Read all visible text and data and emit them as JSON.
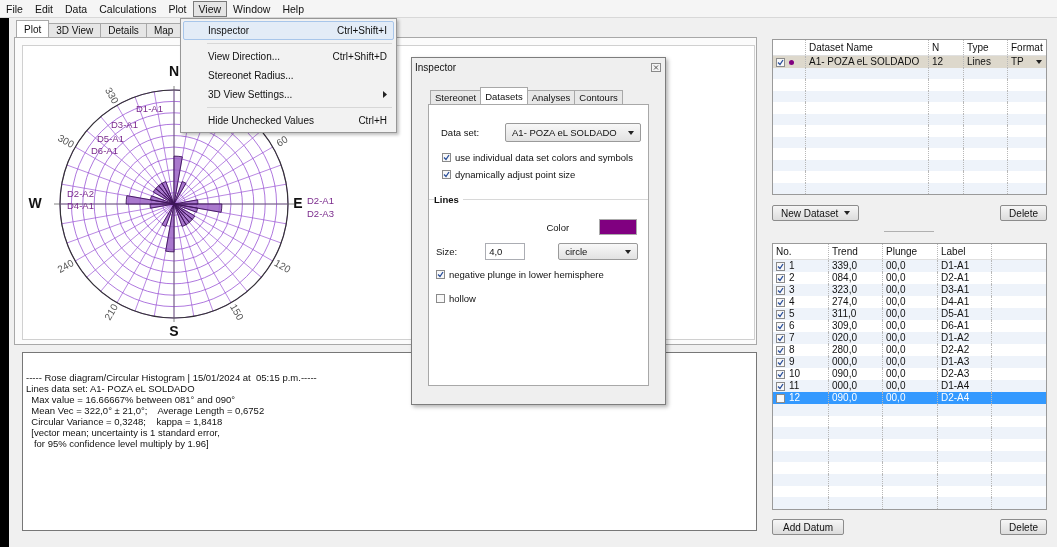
{
  "menu_bar": [
    {
      "label": "File",
      "selected": false
    },
    {
      "label": "Edit",
      "selected": false
    },
    {
      "label": "Data",
      "selected": false
    },
    {
      "label": "Calculations",
      "selected": false
    },
    {
      "label": "Plot",
      "selected": false
    },
    {
      "label": "View",
      "selected": true
    },
    {
      "label": "Window",
      "selected": false
    },
    {
      "label": "Help",
      "selected": false
    }
  ],
  "view_menu": [
    {
      "kind": "item",
      "label": "Inspector",
      "shortcut": "Ctrl+Shift+I",
      "selected": true,
      "submenu": false
    },
    {
      "kind": "separator"
    },
    {
      "kind": "item",
      "label": "View Direction...",
      "shortcut": "Ctrl+Shift+D",
      "selected": false,
      "submenu": false
    },
    {
      "kind": "item",
      "label": "Stereonet Radius...",
      "selected": false,
      "submenu": false
    },
    {
      "kind": "item",
      "label": "3D View Settings...",
      "selected": false,
      "submenu": true
    },
    {
      "kind": "separator"
    },
    {
      "kind": "item",
      "label": "Hide Unchecked Values",
      "shortcut": "Ctrl+H",
      "selected": false,
      "submenu": false
    }
  ],
  "plot_tabs": [
    {
      "label": "Plot",
      "selected": true
    },
    {
      "label": "3D View",
      "selected": false
    },
    {
      "label": "Details",
      "selected": false
    },
    {
      "label": "Map",
      "selected": false
    }
  ],
  "rose_diagram": {
    "cardinals": [
      "N",
      "E",
      "S",
      "W"
    ],
    "ticks": [
      "330",
      "300",
      "60",
      "120",
      "150",
      "210",
      "240"
    ],
    "point_labels": [
      "D1-A1",
      "D3-A1",
      "D5-A1",
      "D6-A1",
      "D2-A2",
      "D4-A1",
      "D2-A1",
      "D2-A3"
    ]
  },
  "output_lines": [
    "----- Rose diagram/Circular Histogram | 15/01/2024 at  05:15 p.m.-----",
    "Lines data set: A1- POZA eL SOLDADO",
    "  Max value = 16.66667% between 081° and 090°",
    "  Mean Vec = 322,0° ± 21,0°;    Average Length = 0,6752",
    "  Circular Variance = 0,3248;    kappa = 1,8418",
    "  [vector mean; uncertainty is 1 standard error,",
    "   for 95% confidence level multiply by 1.96]"
  ],
  "inspector": {
    "title": "Inspector",
    "tabs": [
      {
        "label": "Stereonet",
        "selected": false
      },
      {
        "label": "Datasets",
        "selected": true
      },
      {
        "label": "Analyses",
        "selected": false
      },
      {
        "label": "Contours",
        "selected": false
      }
    ],
    "data_set_label": "Data set:",
    "data_set_value": "A1- POZA eL SOLDADO",
    "options": [
      {
        "label": "use individual data set colors and symbols",
        "checked": true
      },
      {
        "label": "dynamically adjust point size",
        "checked": true
      }
    ],
    "lines_group": {
      "title": "Lines",
      "color_label": "Color",
      "color": "#800080",
      "size_label": "Size:",
      "size_value": "4,0",
      "symbol": "circle",
      "options": [
        {
          "label": "negative plunge in lower hemisphere",
          "checked": true
        },
        {
          "label": "hollow",
          "checked": false
        }
      ]
    }
  },
  "datasets_table": {
    "columns": [
      "Dataset Name",
      "N",
      "Type",
      "Format"
    ],
    "rows": [
      {
        "checked": true,
        "color": "#800080",
        "name": "A1- POZA eL SOLDADO",
        "n": "12",
        "type": "Lines",
        "format": "TP"
      }
    ]
  },
  "new_dataset_button": "New Dataset",
  "delete_dataset_button": "Delete",
  "data_table": {
    "columns": [
      "No.",
      "Trend",
      "Plunge",
      "Label"
    ],
    "rows": [
      {
        "checked": true,
        "selected": false,
        "no": "1",
        "trend": "339,0",
        "plunge": "00,0",
        "label": "D1-A1"
      },
      {
        "checked": true,
        "selected": false,
        "no": "2",
        "trend": "084,0",
        "plunge": "00,0",
        "label": "D2-A1"
      },
      {
        "checked": true,
        "selected": false,
        "no": "3",
        "trend": "323,0",
        "plunge": "00,0",
        "label": "D3-A1"
      },
      {
        "checked": true,
        "selected": false,
        "no": "4",
        "trend": "274,0",
        "plunge": "00,0",
        "label": "D4-A1"
      },
      {
        "checked": true,
        "selected": false,
        "no": "5",
        "trend": "311,0",
        "plunge": "00,0",
        "label": "D5-A1"
      },
      {
        "checked": true,
        "selected": false,
        "no": "6",
        "trend": "309,0",
        "plunge": "00,0",
        "label": "D6-A1"
      },
      {
        "checked": true,
        "selected": false,
        "no": "7",
        "trend": "020,0",
        "plunge": "00,0",
        "label": "D1-A2"
      },
      {
        "checked": true,
        "selected": false,
        "no": "8",
        "trend": "280,0",
        "plunge": "00,0",
        "label": "D2-A2"
      },
      {
        "checked": true,
        "selected": false,
        "no": "9",
        "trend": "000,0",
        "plunge": "00,0",
        "label": "D1-A3"
      },
      {
        "checked": true,
        "selected": false,
        "no": "10",
        "trend": "090,0",
        "plunge": "00,0",
        "label": "D2-A3"
      },
      {
        "checked": true,
        "selected": false,
        "no": "11",
        "trend": "000,0",
        "plunge": "00,0",
        "label": "D1-A4"
      },
      {
        "checked": false,
        "selected": true,
        "no": "12",
        "trend": "090,0",
        "plunge": "00,0",
        "label": "D2-A4"
      }
    ]
  },
  "add_datum_button": "Add Datum",
  "delete_datum_button": "Delete"
}
